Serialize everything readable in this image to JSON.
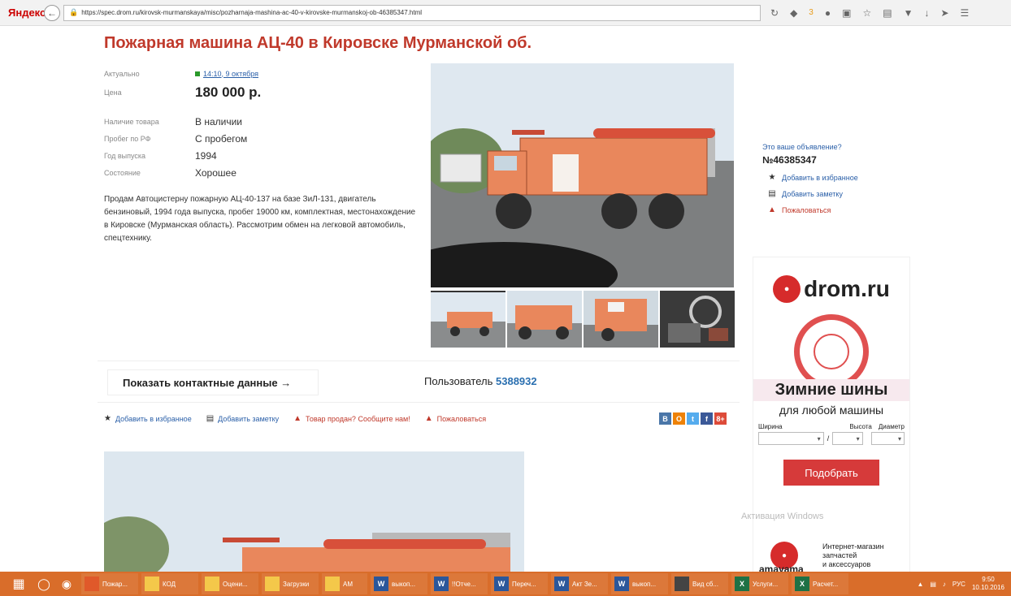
{
  "browser": {
    "yandex_label": "Яндекс",
    "url": "https://spec.drom.ru/kirovsk-murmanskaya/misc/pozharnaja-mashina-ac-40-v-kirovske-murmanskoj-ob-46385347.html",
    "badge_count": "3"
  },
  "listing": {
    "title": "Пожарная машина АЦ-40 в Кировске Мурманской об.",
    "params": {
      "actual_label": "Актуально",
      "actual_value": "14:10, 9 октября",
      "price_label": "Цена",
      "price_value": "180 000 р.",
      "availability_label": "Наличие товара",
      "availability_value": "В наличии",
      "mileage_label": "Пробег по РФ",
      "mileage_value": "С пробегом",
      "year_label": "Год выпуска",
      "year_value": "1994",
      "condition_label": "Состояние",
      "condition_value": "Хорошее"
    },
    "description": "Продам Автоцистерну пожарную АЦ-40-137 на базе ЗиЛ-131, двигатель бензиновый, 1994 года выпуска, пробег 19000 км, комплектная, местонахождение в Кировске (Мурманская область). Рассмотрим обмен на легковой автомобиль, спецтехнику."
  },
  "aside": {
    "question": "Это ваше объявление?",
    "number": "№46385347",
    "add_favorite": "Добавить в избранное",
    "add_note": "Добавить заметку",
    "complain": "Пожаловаться"
  },
  "contact": {
    "show_contacts": "Показать контактные данные →",
    "user_label": "Пользователь",
    "user_id": "5388932"
  },
  "actions": {
    "add_favorite": "Добавить в избранное",
    "add_note": "Добавить заметку",
    "sold": "Товар продан? Сообщите нам!",
    "complain": "Пожаловаться",
    "social": [
      "В",
      "О",
      "t",
      "f",
      "8+"
    ]
  },
  "ad": {
    "brand": "drom.ru",
    "headline": "Зимние шины",
    "subheadline": "для любой машины",
    "width_label": "Ширина",
    "height_label": "Высота",
    "diameter_label": "Диаметр",
    "separator": "/",
    "button": "Подобрать"
  },
  "watermark": "Активация Windows",
  "amayama": {
    "brand": "amayama",
    "line1": "Интернет-магазин",
    "line2": "запчастей",
    "line3": "и аксессуаров"
  },
  "taskbar": {
    "items": [
      "Пожар...",
      "КОД",
      "Оцени...",
      "Загрузки",
      "АМ",
      "выкоп...",
      "!!Отче...",
      "Переч...",
      "Акт Зе...",
      "выкоп...",
      "Вид сб...",
      "Услуги...",
      "Расчет..."
    ],
    "lang": "РУС",
    "time": "9:50",
    "date": "10.10.2016"
  },
  "colors": {
    "title_red": "#c0392b",
    "link_blue": "#2a5fa8",
    "taskbar": "#d96d2a",
    "ad_button": "#d63a3a"
  }
}
